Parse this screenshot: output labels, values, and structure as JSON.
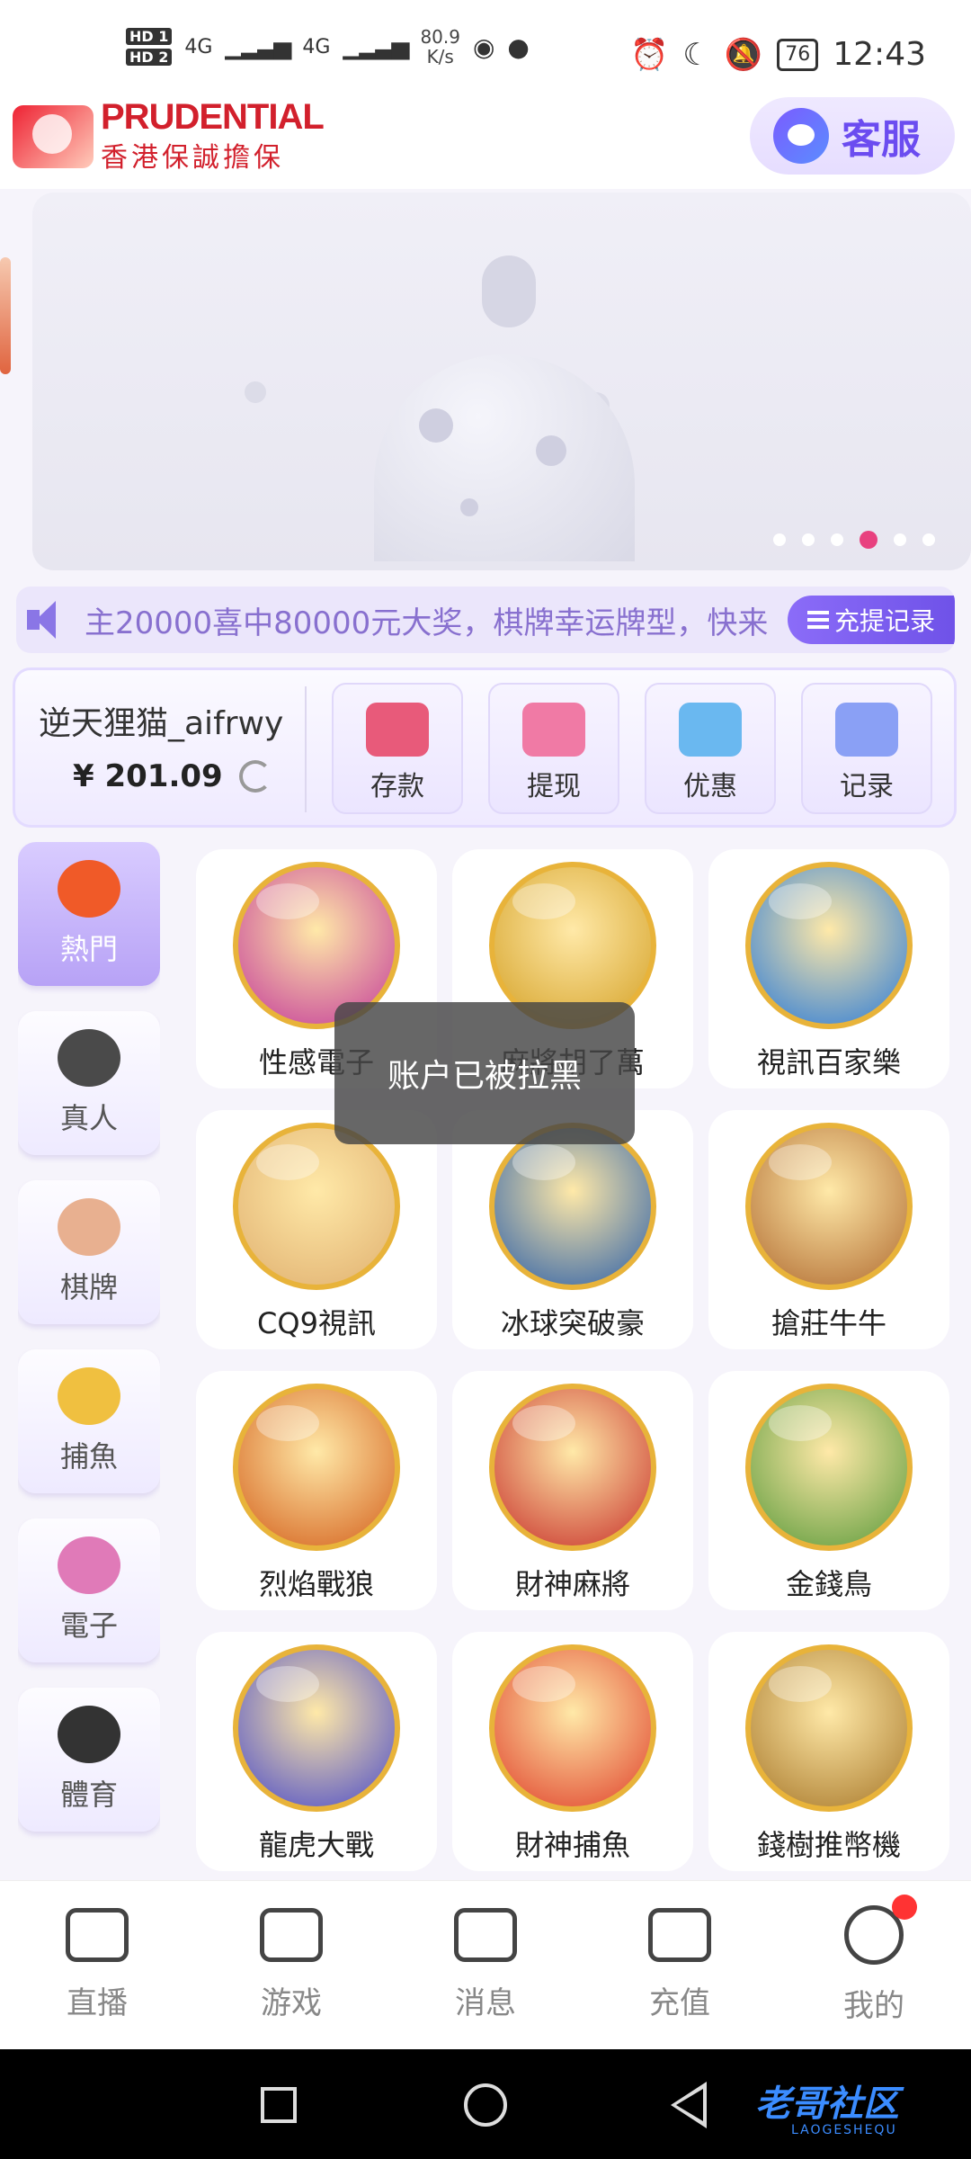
{
  "status_bar": {
    "hd1": "HD 1",
    "hd2": "HD 2",
    "net1": "4G",
    "net2": "4G",
    "speed_value": "80.9",
    "speed_unit": "K/s",
    "battery": "76",
    "time": "12:43"
  },
  "header": {
    "brand_en": "PRUDENTIAL",
    "brand_zh": "香港保誠擔保",
    "service_label": "客服"
  },
  "banner": {
    "dots": [
      false,
      false,
      false,
      true,
      false,
      false
    ]
  },
  "marquee": {
    "text": "主20000喜中80000元大奖，棋牌幸运牌型，快来",
    "record_button": "充提记录"
  },
  "wallet": {
    "username": "逆天狸猫_aifrwy",
    "balance": "¥ 201.09",
    "actions": [
      {
        "label": "存款",
        "icon": "card-icon",
        "color": "#e85a7a"
      },
      {
        "label": "提现",
        "icon": "money-bag-icon",
        "color": "#f07aa5"
      },
      {
        "label": "优惠",
        "icon": "gift-icon",
        "color": "#6ab8f0"
      },
      {
        "label": "记录",
        "icon": "bar-chart-icon",
        "color": "#8aa0f5"
      }
    ]
  },
  "categories": [
    {
      "label": "熱門",
      "icon": "flame-icon",
      "active": true,
      "color": "#f05a28"
    },
    {
      "label": "真人",
      "icon": "chip-icon",
      "active": false,
      "color": "#4a4a4a"
    },
    {
      "label": "棋牌",
      "icon": "cards-icon",
      "active": false,
      "color": "#e8b090"
    },
    {
      "label": "捕魚",
      "icon": "fish-icon",
      "active": false,
      "color": "#f0c040"
    },
    {
      "label": "電子",
      "icon": "slot-icon",
      "active": false,
      "color": "#e07ab8"
    },
    {
      "label": "體育",
      "icon": "soccer-ball-icon",
      "active": false,
      "color": "#333333"
    }
  ],
  "games": [
    {
      "name": "性感電子",
      "color": "#c43a9a"
    },
    {
      "name": "麻將胡了萬",
      "color": "#d4a024"
    },
    {
      "name": "視訊百家樂",
      "color": "#2a7ad8"
    },
    {
      "name": "CQ9視訊",
      "color": "#e0b070"
    },
    {
      "name": "冰球突破豪",
      "color": "#2c5fa8"
    },
    {
      "name": "搶莊牛牛",
      "color": "#b06a30"
    },
    {
      "name": "烈焰戰狼",
      "color": "#d4601c"
    },
    {
      "name": "財神麻將",
      "color": "#c8302a"
    },
    {
      "name": "金錢鳥",
      "color": "#5a9a3a"
    },
    {
      "name": "龍虎大戰",
      "color": "#4a4ac8"
    },
    {
      "name": "財神捕魚",
      "color": "#e0402a"
    },
    {
      "name": "錢樹推幣機",
      "color": "#a8782a"
    }
  ],
  "toast": "账户已被拉黑",
  "tabbar": [
    {
      "label": "直播",
      "icon": "camera-icon"
    },
    {
      "label": "游戏",
      "icon": "gamepad-icon"
    },
    {
      "label": "消息",
      "icon": "message-icon"
    },
    {
      "label": "充值",
      "icon": "wallet-icon"
    },
    {
      "label": "我的",
      "icon": "smiley-icon",
      "badge": true
    }
  ],
  "watermark": {
    "main": "老哥社区",
    "sub": "LAOGESHEQU"
  }
}
